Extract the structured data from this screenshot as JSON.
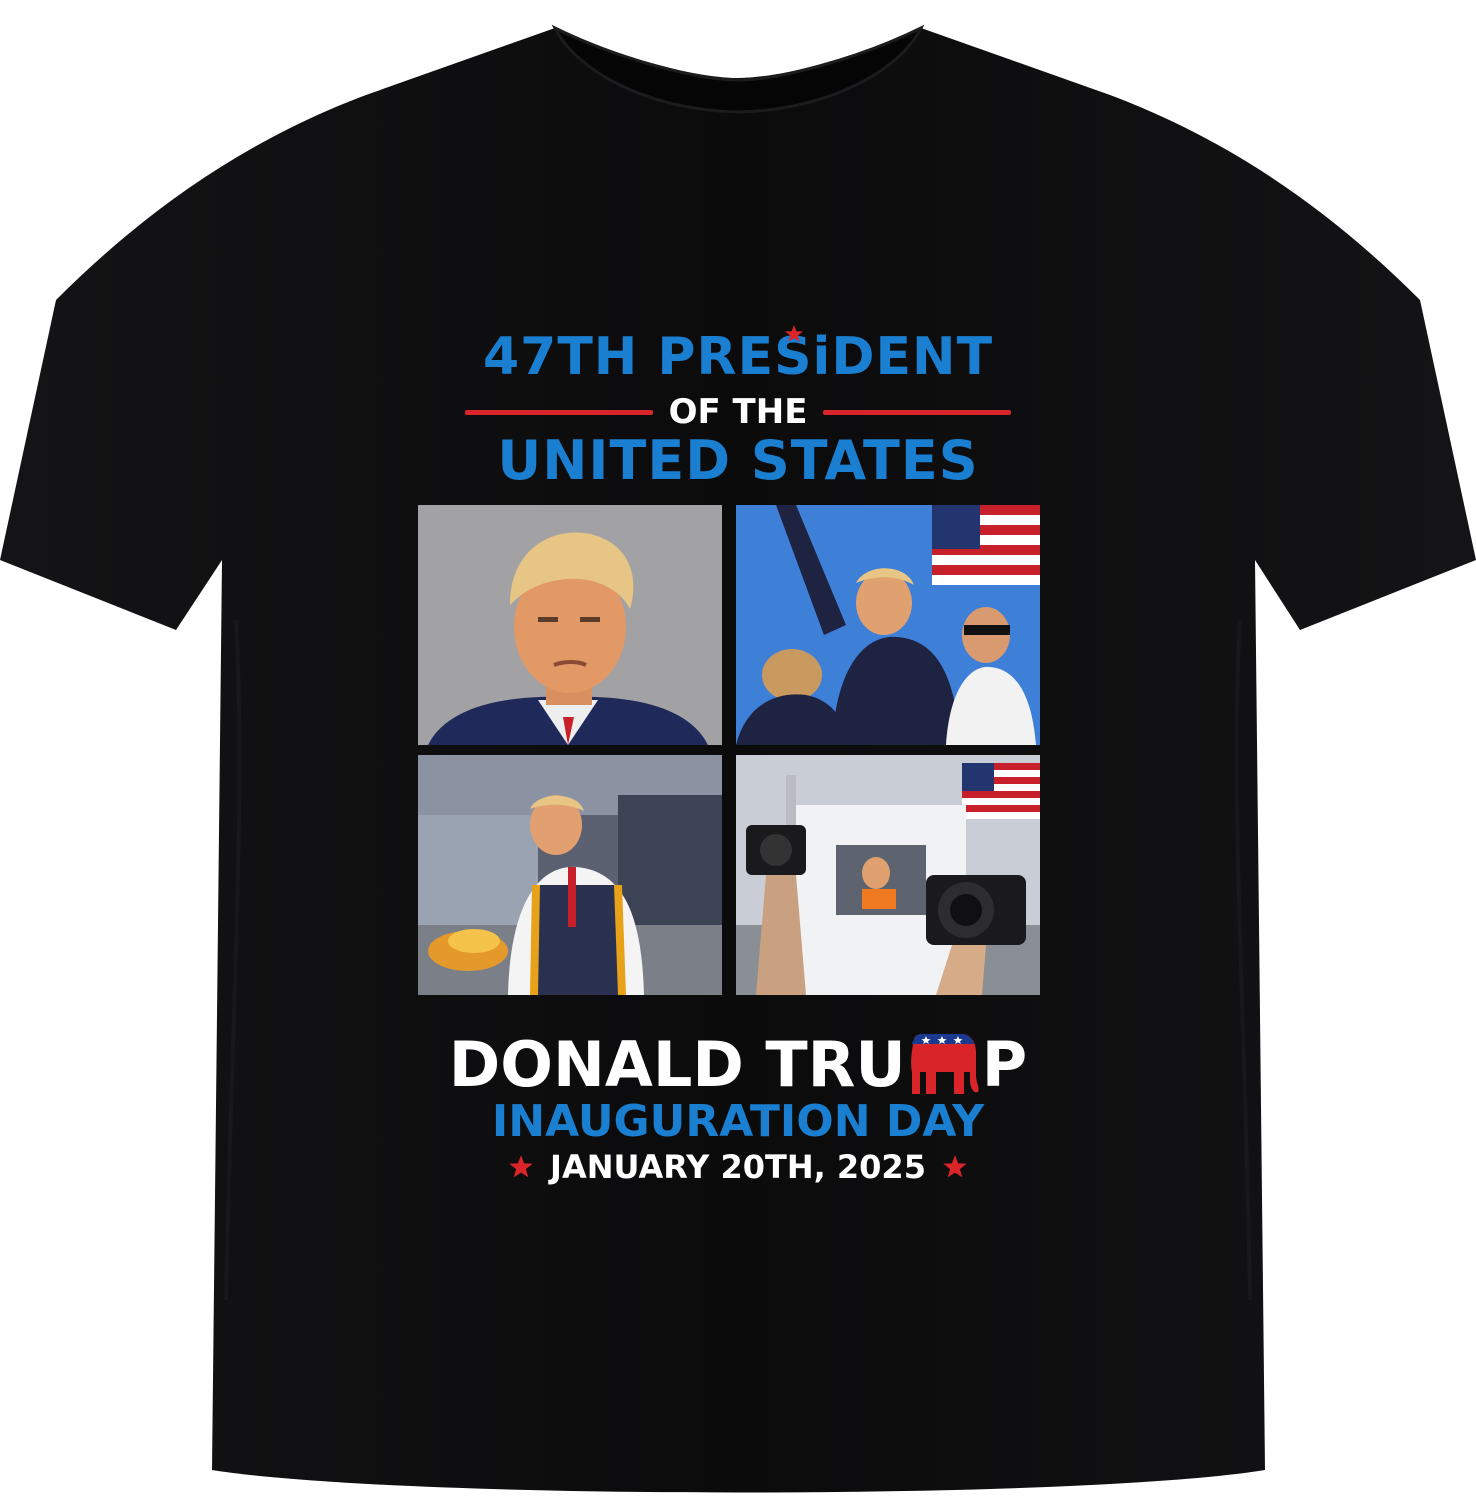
{
  "shirt": {
    "color": "#0b0b0c",
    "background": "#ffffff"
  },
  "headline": {
    "line1": "47TH PRESiDENT",
    "line2": "OF THE",
    "line3": "UNITED STATES",
    "blue": "#1a7fd0",
    "red": "#d9252a"
  },
  "photos": [
    {
      "name": "mugshot"
    },
    {
      "name": "rally-fist"
    },
    {
      "name": "kitchen-fries"
    },
    {
      "name": "garbage-truck"
    }
  ],
  "footer": {
    "name_prefix": "DONALD TRU",
    "name_suffix": "P",
    "event": "INAUGURATION DAY",
    "date": "JANUARY 20TH, 2025",
    "emblem_icon": "republican-elephant-icon",
    "star_icon": "star-icon"
  }
}
